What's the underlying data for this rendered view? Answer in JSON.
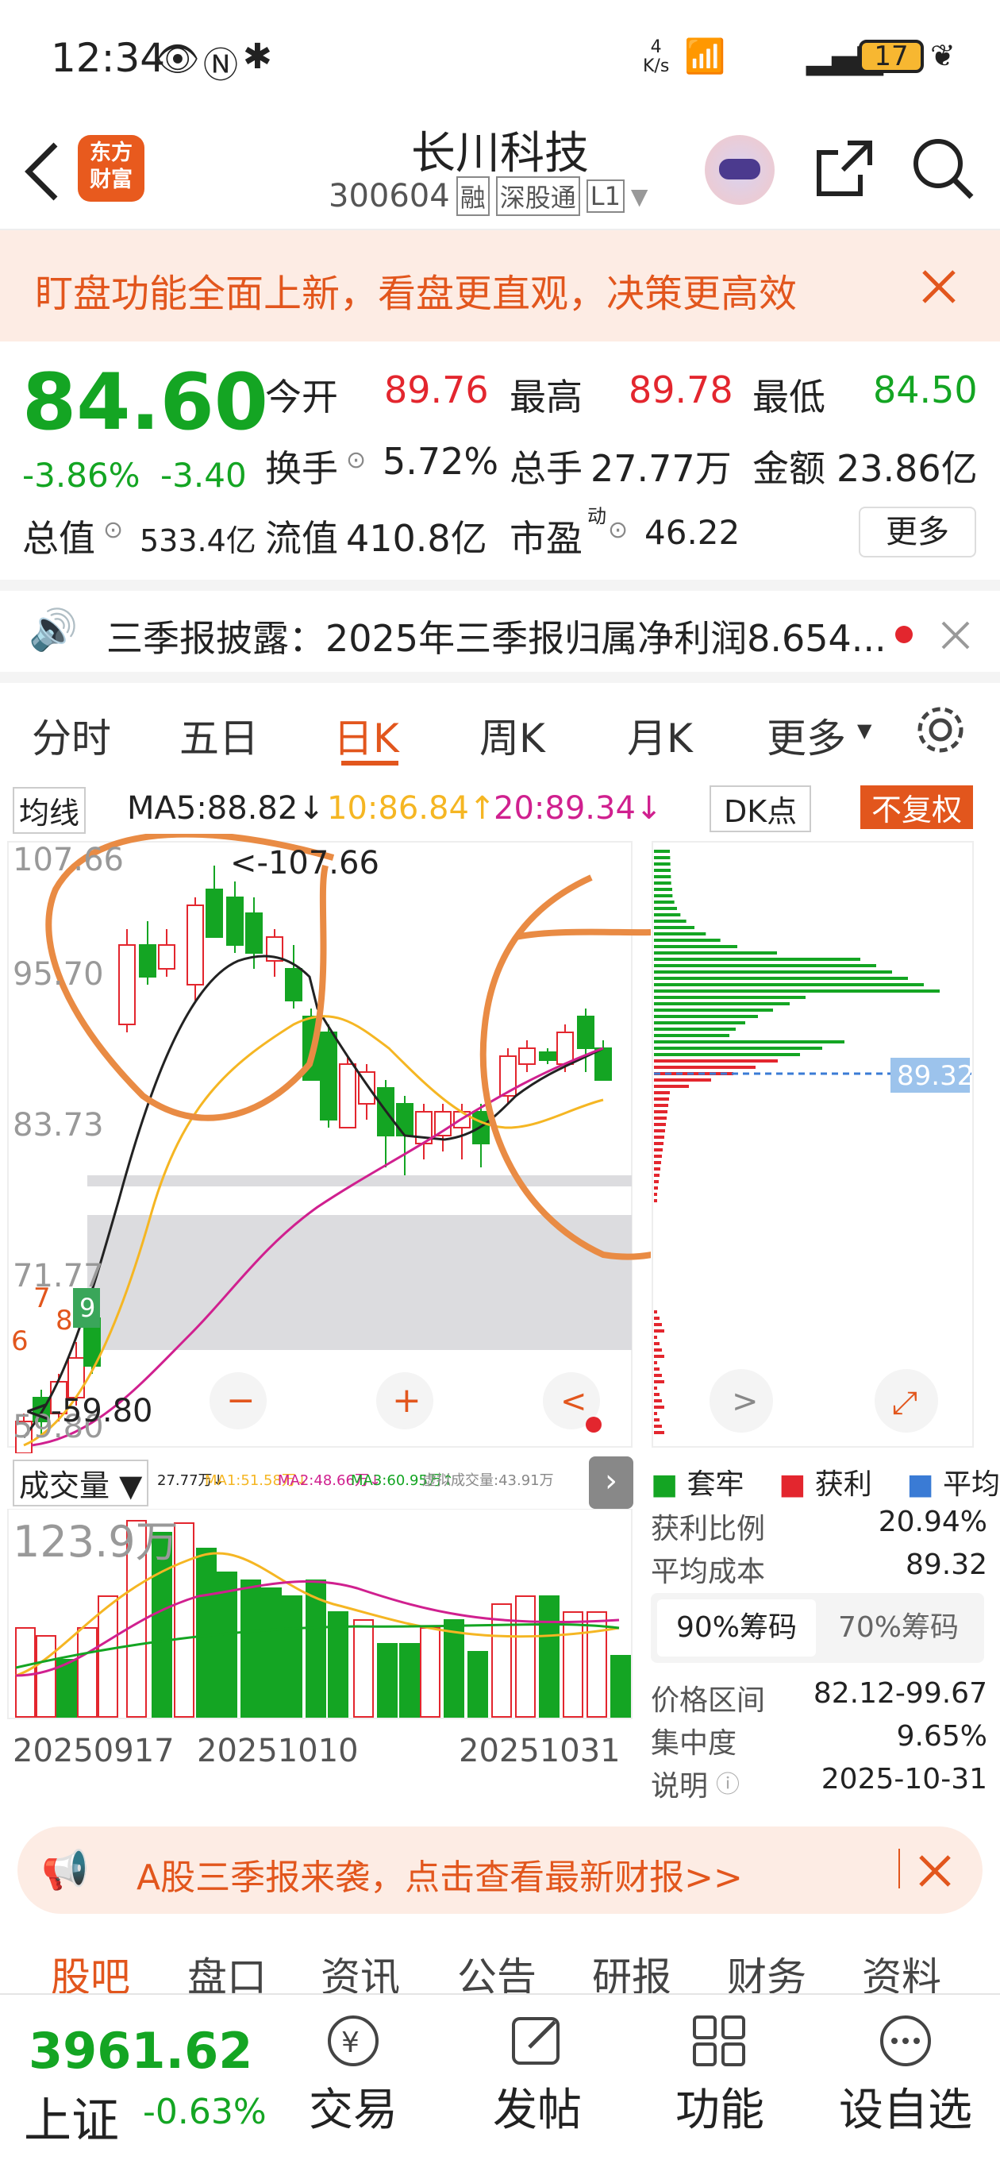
{
  "status": {
    "time": "12:34",
    "speed": "4\nK/s",
    "battery": "17"
  },
  "nav": {
    "title": "长川科技",
    "code": "300604",
    "tags": [
      "融",
      "深股通",
      "L1"
    ],
    "logo": "东方\n财富"
  },
  "banner": {
    "text": "盯盘功能全面上新，看盘更直观，决策更高效"
  },
  "quote": {
    "price": "84.60",
    "pct": "-3.86%",
    "chg": "-3.40",
    "open_label": "今开",
    "open": "89.76",
    "high_label": "最高",
    "high": "89.78",
    "low_label": "最低",
    "low": "84.50",
    "turnover_label": "换手",
    "turnover": "5.72%",
    "vol_label": "总手",
    "vol": "27.77万",
    "amount_label": "金额",
    "amount": "23.86亿",
    "mcap_label": "总值",
    "mcap": "533.4亿",
    "float_label": "流值",
    "float": "410.8亿",
    "pe_label": "市盈",
    "pe_sup": "动",
    "pe": "46.22",
    "more": "更多"
  },
  "notice": {
    "text": "三季报披露：2025年三季报归属净利润8.654..."
  },
  "tabs": [
    "分时",
    "五日",
    "日K",
    "周K",
    "月K",
    "更多"
  ],
  "active_tab": "日K",
  "ma": {
    "label": "均线",
    "ma5": "MA5:88.82↓",
    "ma10": "10:86.84↑",
    "ma20": "20:89.34↓",
    "dk": "DK点",
    "fq": "不复权"
  },
  "price_axis": [
    "107.66",
    "95.70",
    "83.73",
    "71.77",
    "59.80"
  ],
  "annot": {
    "high": "<-107.66",
    "low": "<-59.80",
    "badge_n": "9",
    "n7": "7",
    "n8": "8",
    "n6": "6",
    "cost_tag": "89.32"
  },
  "vol": {
    "label": "成交量",
    "stats": "27.77万↓",
    "ma1": "MA1:51.58万↓",
    "ma2": "MA2:48.66万↓",
    "ma3": "MA3:60.95万↑",
    "virt": "虚拟成交量:43.91万",
    "max": "123.9万",
    "dates": [
      "20250917",
      "20251010",
      "20251031"
    ]
  },
  "chip": {
    "legend": [
      "套牢",
      "获利",
      "平均"
    ],
    "profit_label": "获利比例",
    "profit": "20.94%",
    "avg_label": "平均成本",
    "avg": "89.32",
    "tab1": "90%筹码",
    "tab2": "70%筹码",
    "range_label": "价格区间",
    "range": "82.12-99.67",
    "conc_label": "集中度",
    "conc": "9.65%",
    "note_label": "说明",
    "note": "2025-10-31"
  },
  "ad": {
    "text": "A股三季报来袭，点击查看最新财报>>"
  },
  "subtabs": [
    "股吧",
    "盘口",
    "资讯",
    "公告",
    "研报",
    "财务",
    "资料"
  ],
  "index": {
    "value": "3961.62",
    "name": "上证",
    "pct": "-0.63%"
  },
  "bottom": [
    "交易",
    "发帖",
    "功能",
    "设自选"
  ],
  "colors": {
    "up": "#e3262e",
    "down": "#14a523",
    "accent": "#e2561d",
    "ma5": "#222222",
    "ma10": "#f5b623",
    "ma20": "#d0208f"
  }
}
